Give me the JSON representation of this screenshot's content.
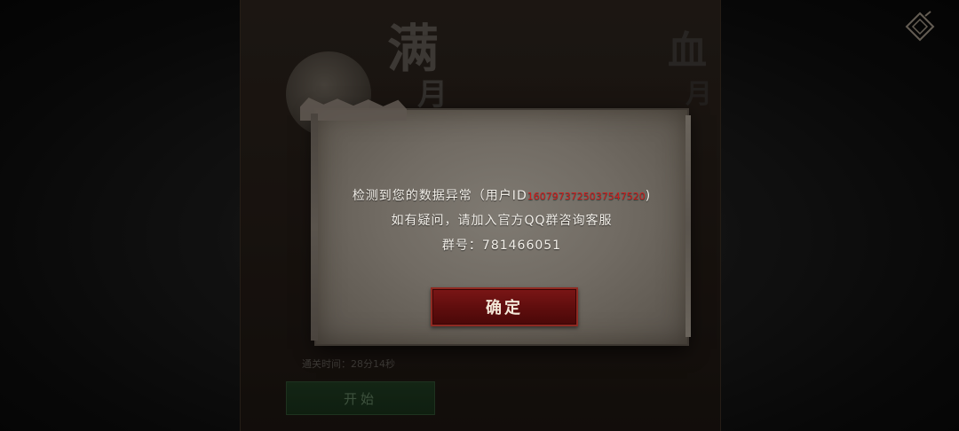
{
  "background": {
    "title_left": "满",
    "title_left_sub": "月",
    "title_right": "血",
    "title_right_sub": "月",
    "clear_time": "通关时间：28分14秒",
    "start_button": "开始"
  },
  "dialog": {
    "line1_prefix": "检测到您的数据异常（用户ID",
    "user_id": "1607973725037547520",
    "line1_suffix": ")",
    "line2": "如有疑问，请加入官方QQ群咨询客服",
    "line3": "群号：781466051",
    "confirm_label": "确定"
  },
  "colors": {
    "user_id": "#d11c1c",
    "confirm_bg": "#5e0d0d",
    "start_bg": "#1f3a21"
  },
  "icons": {
    "corner": "menu-diamond-icon"
  }
}
